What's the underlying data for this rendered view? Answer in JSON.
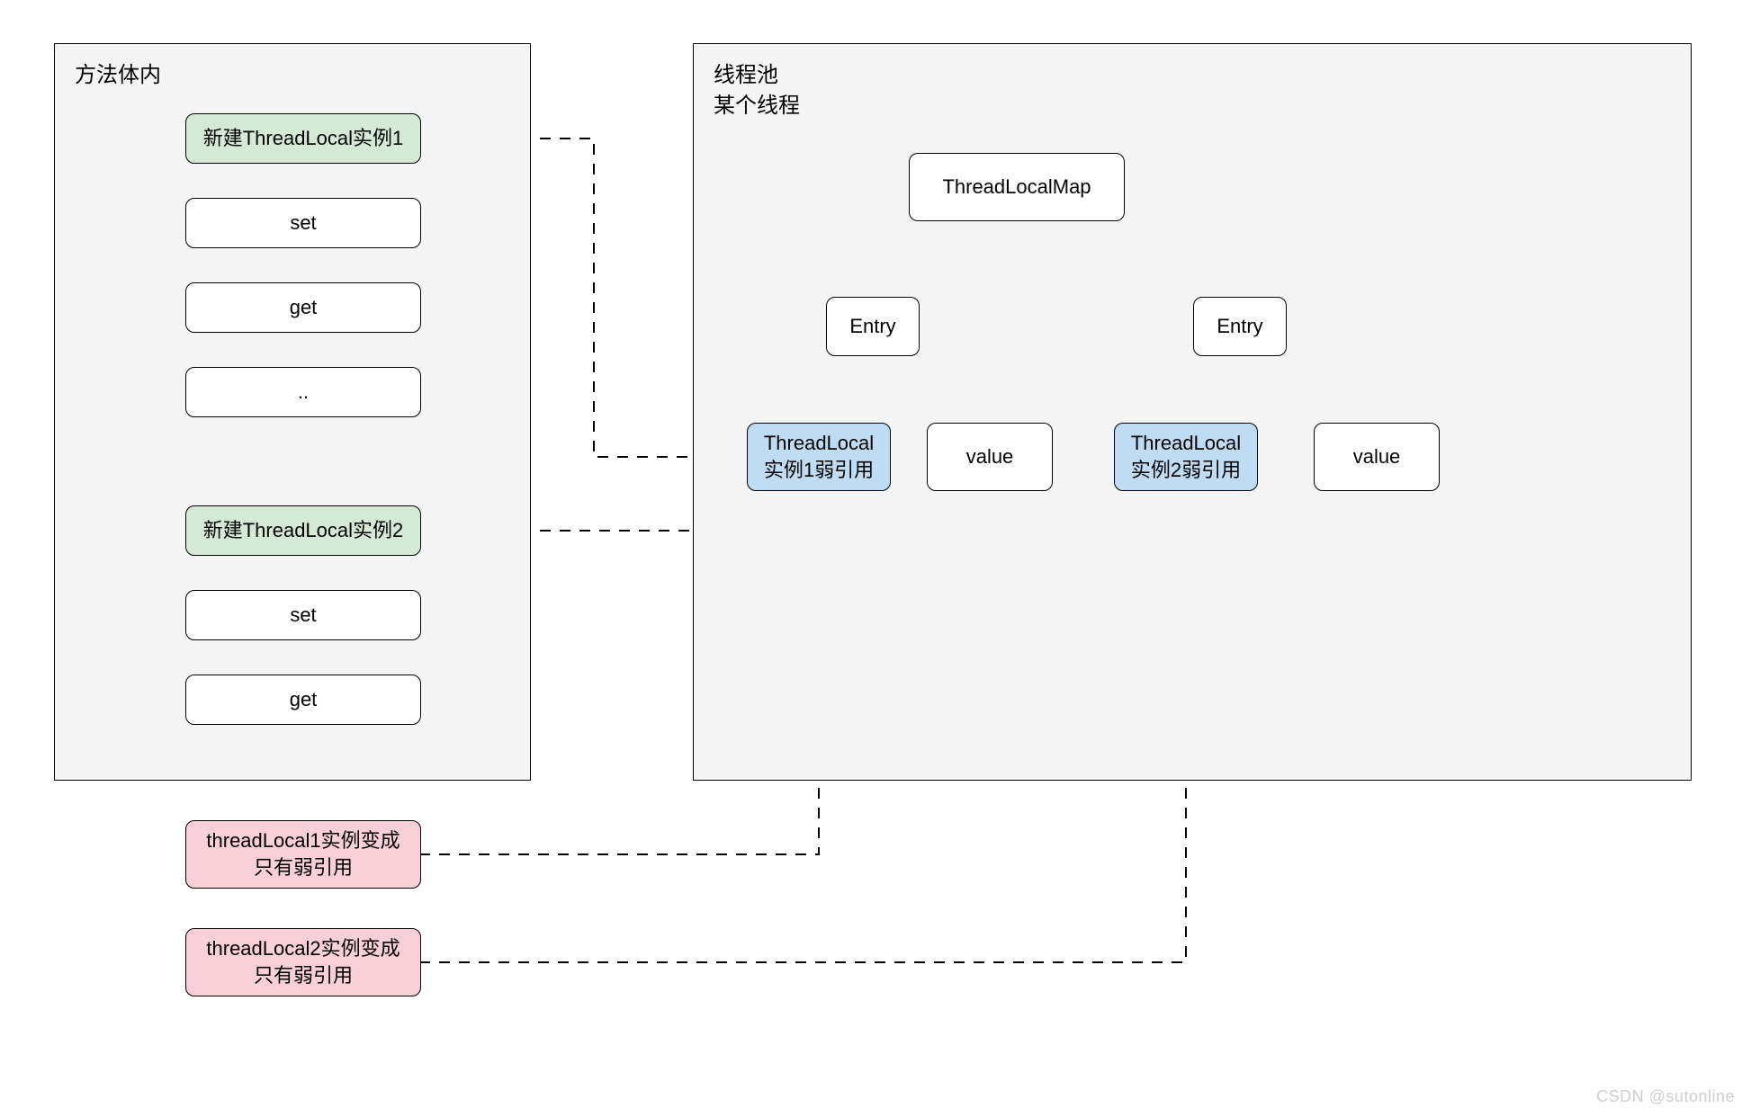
{
  "left_panel": {
    "title": "方法体内",
    "nodes": {
      "new1": "新建ThreadLocal实例1",
      "set1": "set",
      "get1": "get",
      "dots": "..",
      "new2": "新建ThreadLocal实例2",
      "set2": "set",
      "get2": "get"
    }
  },
  "right_panel": {
    "title": "线程池\n某个线程",
    "nodes": {
      "map": "ThreadLocalMap",
      "entry1": "Entry",
      "entry2": "Entry",
      "tl1": "ThreadLocal\n实例1弱引用",
      "val1": "value",
      "tl2": "ThreadLocal\n实例2弱引用",
      "val2": "value"
    }
  },
  "bottom": {
    "weak1": "threadLocal1实例变成\n只有弱引用",
    "weak2": "threadLocal2实例变成\n只有弱引用"
  },
  "watermark": "CSDN @sutonline"
}
